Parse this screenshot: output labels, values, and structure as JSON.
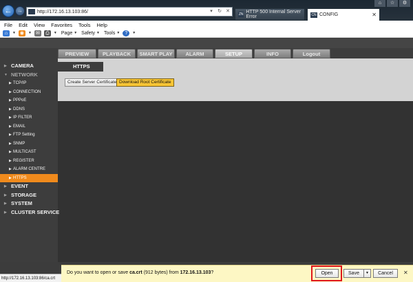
{
  "browser": {
    "address": "http://172.16.13.103:86/",
    "tabs": [
      {
        "label": "HTTP 500 Internal Server Error",
        "icon_text": "ZN"
      },
      {
        "label": "CONFIG",
        "icon_text": "CN"
      }
    ],
    "menu": [
      "File",
      "Edit",
      "View",
      "Favorites",
      "Tools",
      "Help"
    ],
    "commands": {
      "page": "Page",
      "safety": "Safety",
      "tools": "Tools"
    },
    "status_url": "http://172.16.13.103:86/ca.crt"
  },
  "main_nav": [
    {
      "label": "PREVIEW",
      "active": false
    },
    {
      "label": "PLAYBACK",
      "active": false
    },
    {
      "label": "SMART PLAY",
      "active": false
    },
    {
      "label": "ALARM",
      "active": false
    },
    {
      "label": "SETUP",
      "active": true
    },
    {
      "label": "INFO",
      "active": false
    },
    {
      "label": "Logout",
      "active": false
    }
  ],
  "sidebar": {
    "camera": "CAMERA",
    "network": "NETWORK",
    "network_items": [
      "TCP/IP",
      "CONNECTION",
      "PPPoE",
      "DDNS",
      "IP FILTER",
      "EMAIL",
      "FTP Setting",
      "SNMP",
      "MULTICAST",
      "REGISTER",
      "ALARM CENTRE",
      "HTTPS"
    ],
    "event": "EVENT",
    "storage": "STORAGE",
    "system": "SYSTEM",
    "cluster": "CLUSTER SERVICE"
  },
  "content": {
    "tab_title": "HTTPS",
    "create_button": "Create Server Certificate",
    "download_button": "Download Root Certificate"
  },
  "notification": {
    "prefix": "Do you want to open or save ",
    "filename": "ca.crt",
    "size": " (912 bytes) from ",
    "host": "172.16.13.103",
    "suffix": "?",
    "open": "Open",
    "save": "Save",
    "cancel": "Cancel"
  },
  "colors": {
    "active_sidebar": "#f08a1c",
    "download_button": "#f8c535",
    "highlight": "#e0161b"
  }
}
